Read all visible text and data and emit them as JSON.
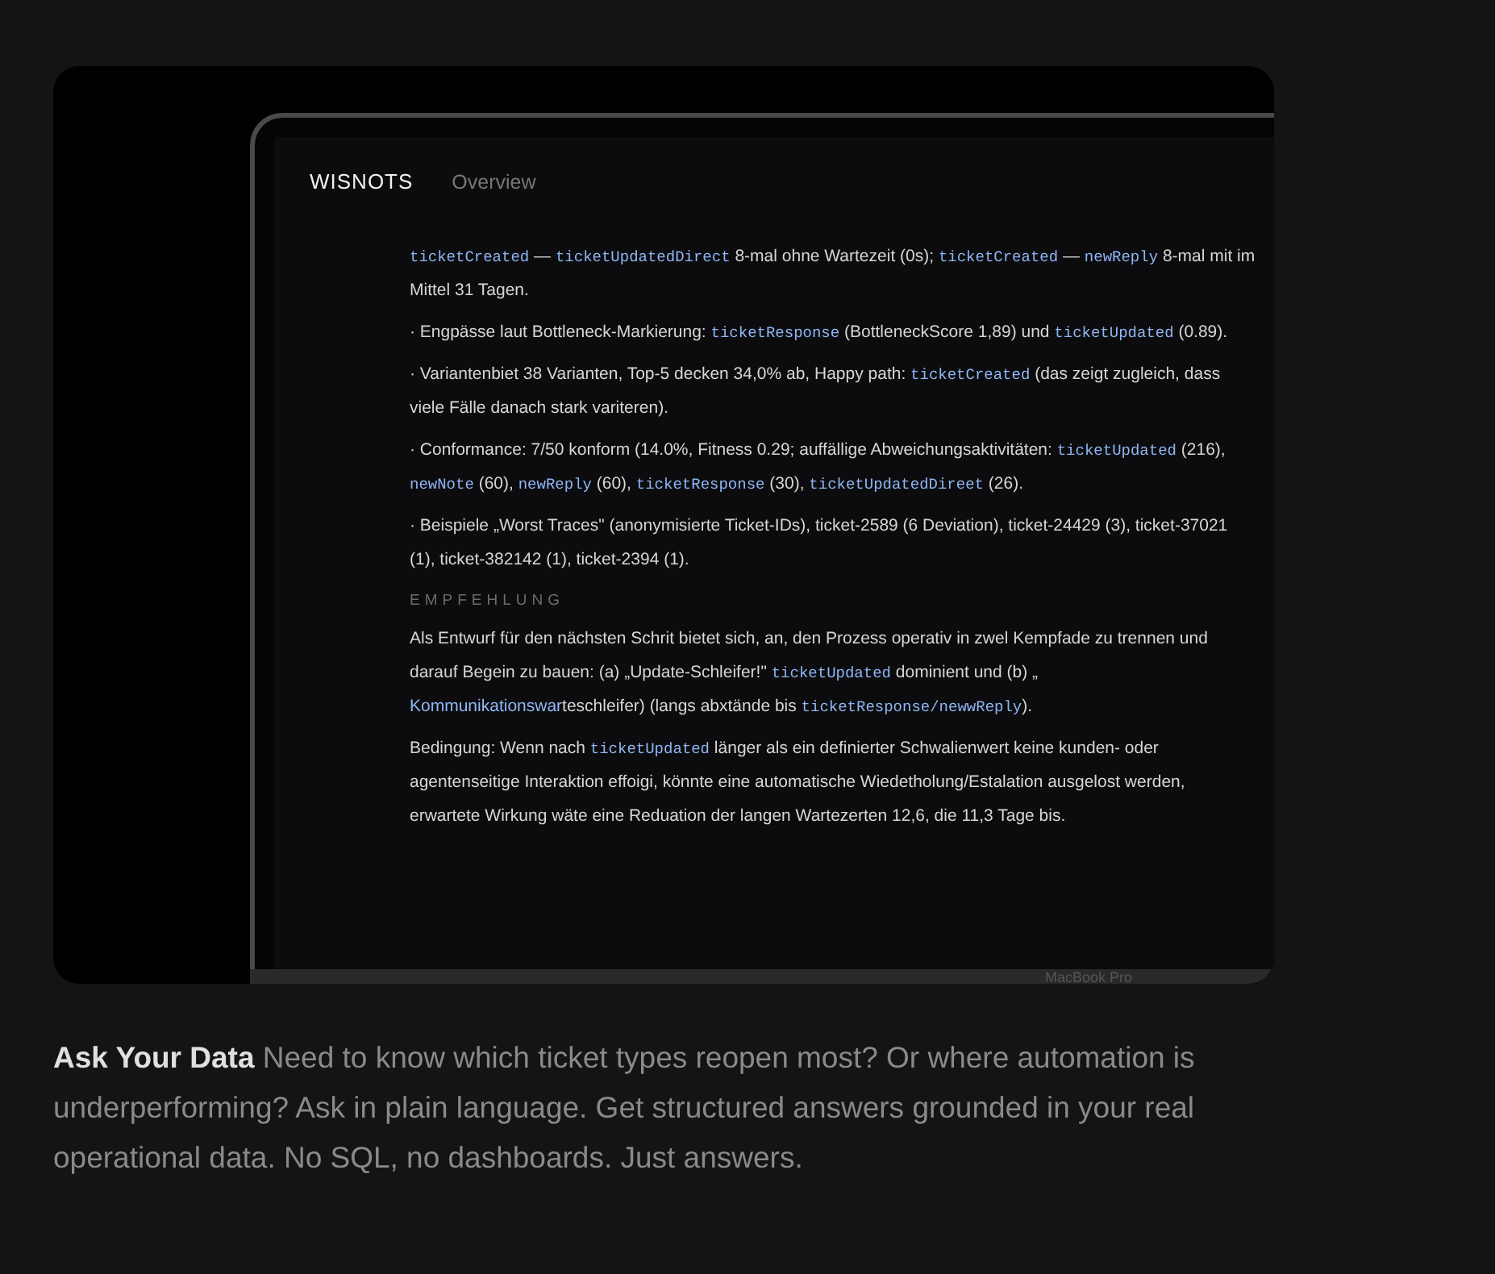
{
  "app": {
    "brand": "WISNOTS",
    "nav": "Overview",
    "paragraphs": [
      {
        "kind": "body",
        "segments": [
          {
            "kind": "code",
            "text": "ticketCreated"
          },
          {
            "kind": "text",
            "text": " — "
          },
          {
            "kind": "code",
            "text": "ticketUpdatedDirect"
          },
          {
            "kind": "text",
            "text": " 8-mal ohne Wartezeit (0s); "
          },
          {
            "kind": "code",
            "text": "ticketCreated"
          },
          {
            "kind": "text",
            "text": " — "
          },
          {
            "kind": "code",
            "text": "newReply"
          },
          {
            "kind": "text",
            "text": " 8-mal mit im Mittel 31 Tagen."
          }
        ]
      },
      {
        "kind": "body",
        "segments": [
          {
            "kind": "text",
            "text": "·  Engpässe laut Bottleneck-Markierung: "
          },
          {
            "kind": "code",
            "text": "ticketResponse"
          },
          {
            "kind": "text",
            "text": " (BottleneckScore 1,89) und "
          },
          {
            "kind": "code",
            "text": "ticketUpdated"
          },
          {
            "kind": "text",
            "text": " (0.89)."
          }
        ]
      },
      {
        "kind": "body",
        "segments": [
          {
            "kind": "text",
            "text": "·  Variantenbiet 38 Varianten, Top-5 decken 34,0% ab, Happy path: "
          },
          {
            "kind": "code",
            "text": "ticketCreated"
          },
          {
            "kind": "text",
            "text": " (das zeigt zugleich, dass viele Fälle danach stark variteren)."
          }
        ]
      },
      {
        "kind": "body",
        "segments": [
          {
            "kind": "text",
            "text": "·  Conformance: 7/50 konform (14.0%, Fitness 0.29; auffällige Abweichungsaktivitäten: "
          },
          {
            "kind": "code",
            "text": "ticketUpdated"
          },
          {
            "kind": "text",
            "text": " (216), "
          },
          {
            "kind": "code",
            "text": "newNote"
          },
          {
            "kind": "text",
            "text": " (60), "
          },
          {
            "kind": "code",
            "text": "newReply"
          },
          {
            "kind": "text",
            "text": " (60), "
          },
          {
            "kind": "code",
            "text": "ticketResponse"
          },
          {
            "kind": "text",
            "text": " (30), "
          },
          {
            "kind": "code",
            "text": "ticketUpdatedDireet"
          },
          {
            "kind": "text",
            "text": " (26)."
          }
        ]
      },
      {
        "kind": "body",
        "segments": [
          {
            "kind": "text",
            "text": "·  Beispiele „Worst Traces\" (anonymisierte Ticket-IDs), ticket-2589 (6 Deviation), ticket-24429 (3), ticket-37021 (1), ticket-382142 (1), ticket-2394 (1)."
          }
        ]
      },
      {
        "kind": "heading",
        "segments": [
          {
            "kind": "text",
            "text": "EMPFEHLUNG"
          }
        ]
      },
      {
        "kind": "body",
        "segments": [
          {
            "kind": "text",
            "text": "Als Entwurf für den nächsten Schrit bietet sich, an, den Prozess operativ in zwel Kempfade zu trennen und darauf Begein zu bauen: (a) „Update-Schleifer!\" "
          },
          {
            "kind": "code",
            "text": "ticketUpdated"
          },
          {
            "kind": "text",
            "text": " dominient und (b) „ "
          },
          {
            "kind": "link",
            "text": "Kommunikationswar"
          },
          {
            "kind": "text",
            "text": "teschleifer) (langs abxtände bis "
          },
          {
            "kind": "code",
            "text": "ticketResponse/newwReply"
          },
          {
            "kind": "text",
            "text": ")."
          }
        ]
      },
      {
        "kind": "body",
        "segments": [
          {
            "kind": "text",
            "text": "Bedingung: Wenn nach "
          },
          {
            "kind": "code",
            "text": "ticketUpdated"
          },
          {
            "kind": "text",
            "text": " länger als ein definierter Schwalienwert keine kunden- oder agentenseitige Interaktion effoigi, könnte eine automatische Wiedetholung/Estalation ausgelost werden, erwartete Wirkung wäte eine Reduation der langen Wartezerten 12,6, die 11,3 Tage bis."
          }
        ]
      }
    ]
  },
  "device_label": "MacBook Pro",
  "caption": {
    "title": "Ask Your Data",
    "text": "Need to know which ticket types reopen most? Or where automation is underperforming? Ask in plain language. Get structured answers grounded in your real operational data. No SQL, no dashboards. Just answers."
  }
}
